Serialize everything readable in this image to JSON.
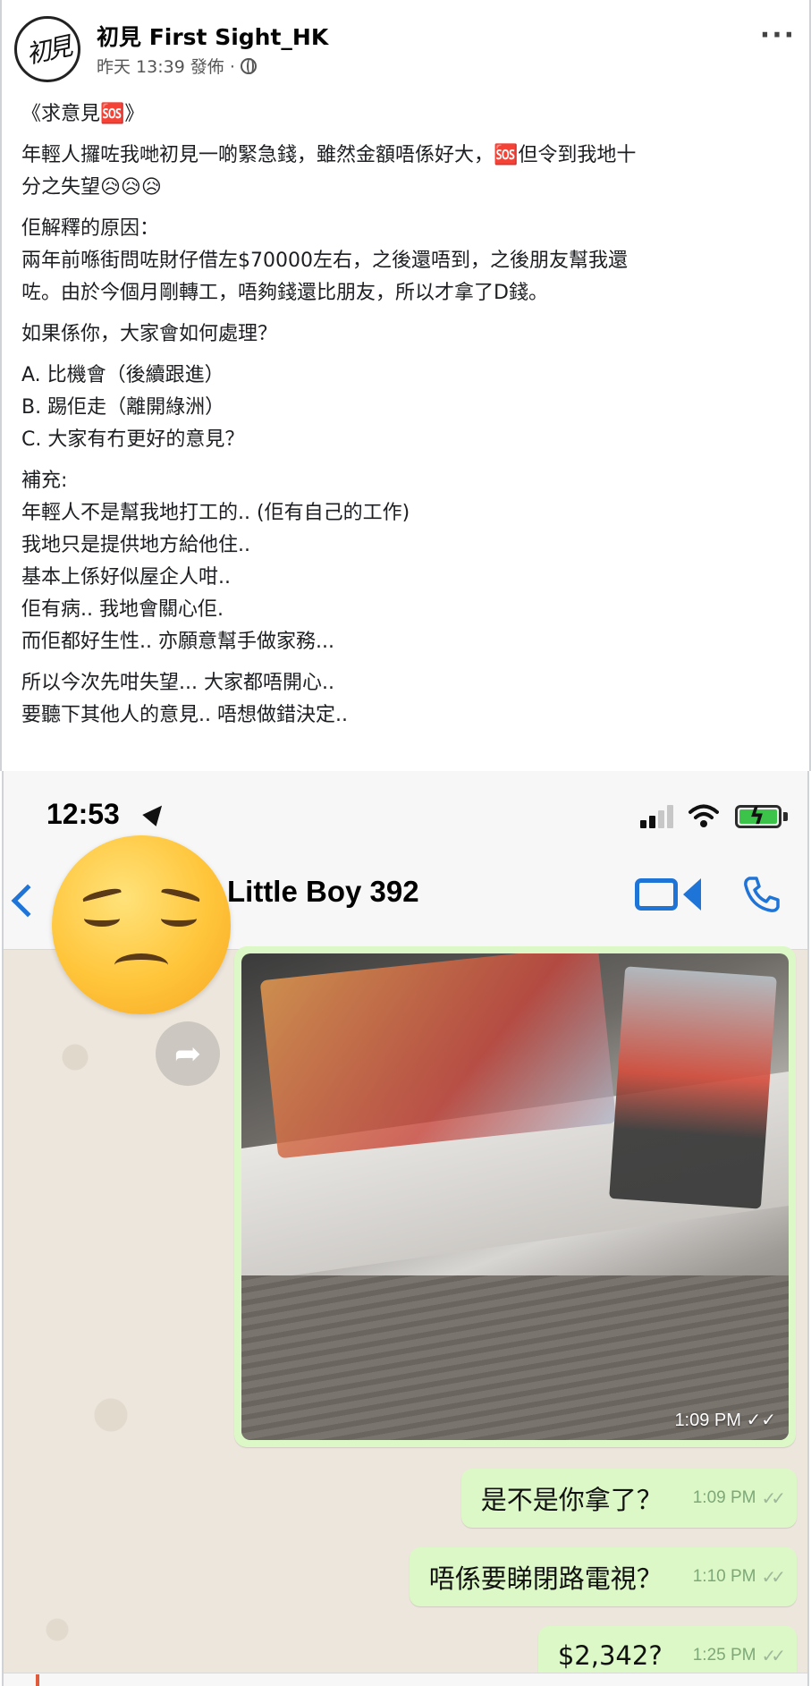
{
  "post": {
    "avatar_text": "初見",
    "page_name": "初見 First Sight_HK",
    "meta_time": "昨天 13:39",
    "meta_action": "發佈 ·",
    "more_label": "···",
    "paragraphs": [
      [
        "《求意見🆘》"
      ],
      [
        "年輕人攞咗我哋初見一啲緊急錢，雖然金額唔係好大，🆘但令到我地十",
        "分之失望😥😥😥"
      ],
      [
        "佢解釋的原因：",
        "兩年前喺街問咗財仔借左$70000左右，之後還唔到，之後朋友幫我還",
        "咗。由於今個月剛轉工，唔夠錢還比朋友，所以才拿了D錢。"
      ],
      [
        "如果係你，大家會如何處理？"
      ],
      [
        "A. 比機會（後續跟進）",
        "B. 踢佢走（離開綠洲）",
        "C. 大家有冇更好的意見？"
      ],
      [
        "補充:",
        "年輕人不是幫我地打工的.. (佢有自己的工作)",
        "我地只是提供地方給他住..",
        "基本上係好似屋企人咁..",
        "佢有病.. 我地會關心佢.",
        "而佢都好生性.. 亦願意幫手做家務..."
      ],
      [
        "所以今次先咁失望... 大家都唔開心..",
        " 要聽下其他人的意見.. 唔想做錯決定.."
      ]
    ]
  },
  "phone": {
    "status_time": "12:53",
    "contact_name": "Little Boy 392",
    "image_time": "1:09 PM",
    "messages": [
      {
        "text": "是不是你拿了？",
        "time": "1:09 PM"
      },
      {
        "text": "唔係要睇閉路電視？",
        "time": "1:10 PM"
      },
      {
        "text": "$2,342?",
        "time": "1:25 PM"
      }
    ],
    "ticks": "✓✓"
  },
  "colors": {
    "ios_blue": "#1f74d8",
    "bubble_green": "#dcf8c6",
    "chat_bg": "#ede6dd"
  },
  "icons": {
    "globe": "globe-icon",
    "more": "more-icon",
    "location": "location-arrow-icon",
    "signal": "signal-icon",
    "wifi": "wifi-icon",
    "battery": "battery-charging-icon",
    "back": "chevron-left-icon",
    "video": "video-call-icon",
    "phone": "phone-call-icon",
    "forward": "forward-icon",
    "emoji": "disappointed-face-emoji"
  }
}
